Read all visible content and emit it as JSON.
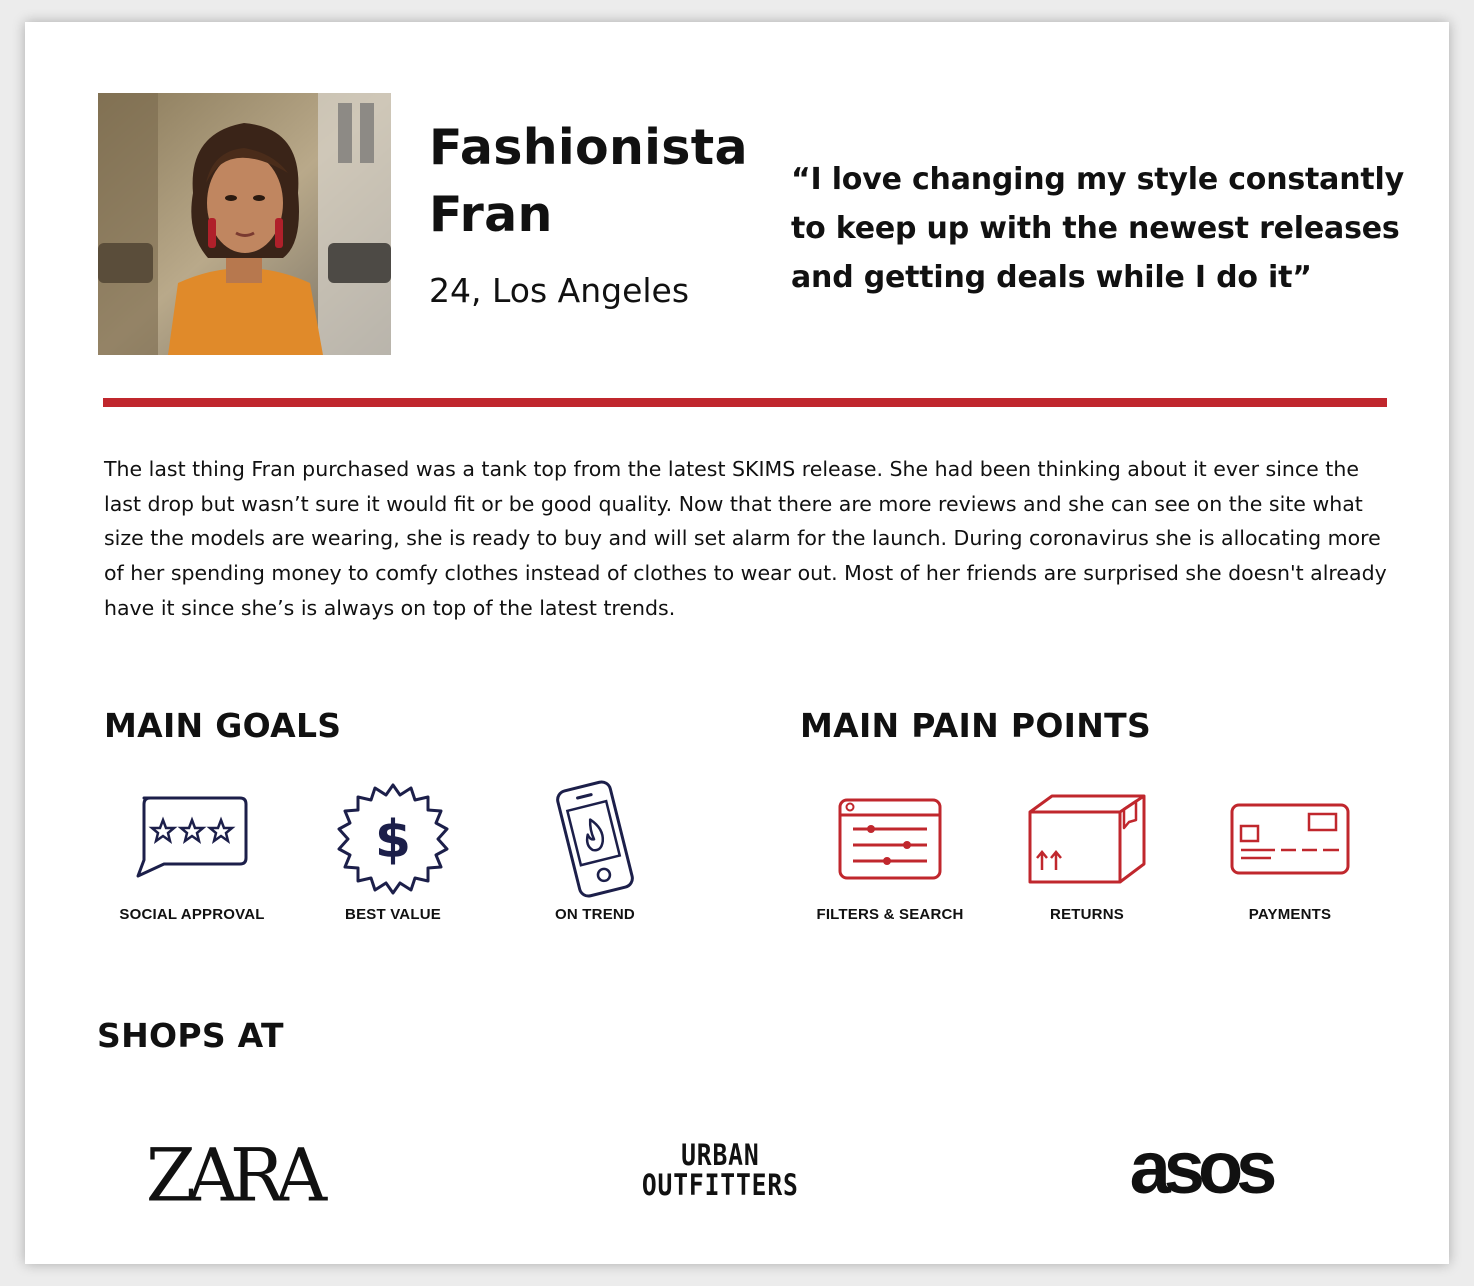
{
  "persona": {
    "name_line1": "Fashionista",
    "name_line2": "Fran",
    "age_location": "24, Los Angeles",
    "quote": "“I love changing my style constantly to keep up with the newest releases and getting deals while I do it”",
    "bio": "The last thing Fran purchased was a tank top from the latest SKIMS release. She had been thinking about it ever since the last drop but wasn’t sure it would fit or be good quality. Now that there are more reviews and she can see on the site what size the models are wearing, she is ready to buy and will set alarm for the launch. During coronavirus she is allocating more of her spending money to comfy clothes instead of clothes to wear out. Most of her friends are surprised she doesn't already have it since she’s is always on top of the latest trends."
  },
  "goals": {
    "title": "MAIN GOALS",
    "items": [
      {
        "label": "SOCIAL APPROVAL",
        "icon": "speech-bubble-stars-icon"
      },
      {
        "label": "BEST VALUE",
        "icon": "dollar-badge-icon"
      },
      {
        "label": "ON TREND",
        "icon": "phone-flame-icon"
      }
    ]
  },
  "pain_points": {
    "title": "MAIN PAIN POINTS",
    "items": [
      {
        "label": "FILTERS & SEARCH",
        "icon": "sliders-window-icon"
      },
      {
        "label": "RETURNS",
        "icon": "box-icon"
      },
      {
        "label": "PAYMENTS",
        "icon": "credit-card-icon"
      }
    ]
  },
  "shops": {
    "title": "SHOPS AT",
    "brands": [
      {
        "logo_text": "ZARA"
      },
      {
        "logo_line1": "URBAN",
        "logo_line2": "OUTFITTERS"
      },
      {
        "logo_text": "asos"
      }
    ]
  },
  "colors": {
    "accent_red": "#c0272d",
    "navy": "#1c1f4a",
    "text": "#111111"
  }
}
